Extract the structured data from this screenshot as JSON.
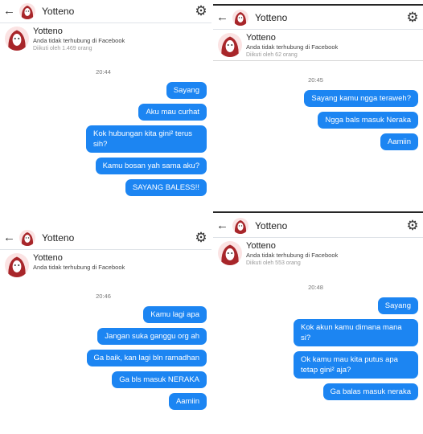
{
  "panels": [
    {
      "contact_name": "Yotteno",
      "profile_name": "Yotteno",
      "connection_text": "Anda tidak terhubung di Facebook",
      "followers_text": "Diikuti oleh 1.469 orang",
      "timestamp": "20:44",
      "messages": [
        "Sayang",
        "Aku mau curhat",
        "Kok hubungan kita gini² terus sih?",
        "Kamu bosan yah sama aku?",
        "SAYANG BALESS!!"
      ]
    },
    {
      "contact_name": "Yotteno",
      "profile_name": "Yotteno",
      "connection_text": "Anda tidak terhubung di Facebook",
      "followers_text": "Diikuti oleh 62 orang",
      "timestamp": "20:45",
      "messages": [
        "Sayang kamu ngga teraweh?",
        "Ngga bals masuk Neraka",
        "Aamiin"
      ]
    },
    {
      "contact_name": "Yotteno",
      "profile_name": "Yotteno",
      "connection_text": "Anda tidak terhubung di Facebook",
      "followers_text": "",
      "timestamp": "20:46",
      "messages": [
        "Kamu lagi apa",
        "Jangan suka ganggu org ah",
        "Ga baik, kan lagi bln ramadhan",
        "Ga bls masuk NERAKA",
        "Aamiin"
      ]
    },
    {
      "contact_name": "Yotteno",
      "profile_name": "Yotteno",
      "connection_text": "Anda tidak terhubung di Facebook",
      "followers_text": "Diikuti oleh 553 orang",
      "timestamp": "20:48",
      "messages": [
        "Sayang",
        "Kok akun kamu dimana mana si?",
        "Ok kamu mau kita putus apa tetap gini² aja?",
        "Ga balas masuk neraka"
      ]
    }
  ],
  "icons": {
    "back": "back-arrow-icon",
    "settings": "gear-icon",
    "avatar": "red-hair-avatar"
  },
  "colors": {
    "bubble": "#1c85f2",
    "bubble_text": "#ffffff",
    "divider": "#dfe3e8"
  }
}
